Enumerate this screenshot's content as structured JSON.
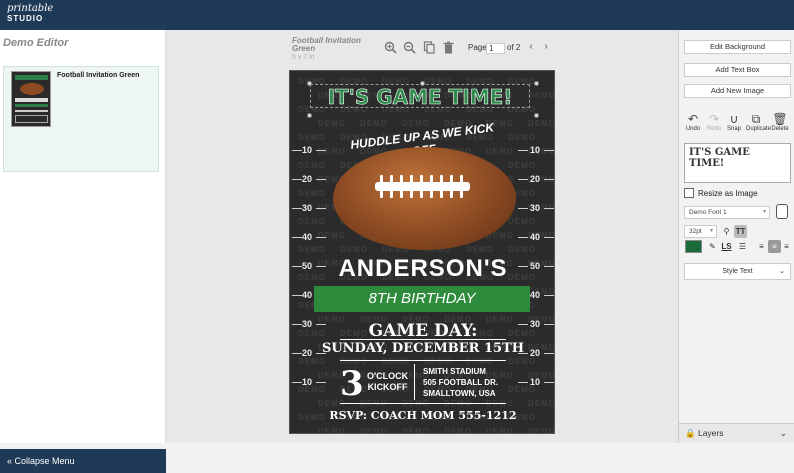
{
  "app": {
    "logo_line1": "printable",
    "logo_line2": "STUDIO"
  },
  "left_panel": {
    "title": "Demo Editor",
    "thumbnail_name": "Football Invitation Green",
    "collapse_label": "Collapse Menu"
  },
  "canvas_toolbar": {
    "doc_title": "Football Invitation Green",
    "doc_size": "5 x 7 in",
    "page_label": "Page",
    "page_value": "1",
    "page_of": "of 2",
    "icons": [
      "zoom-in-icon",
      "zoom-out-icon",
      "copy-icon",
      "trash-icon"
    ]
  },
  "invitation": {
    "banner": "IT'S GAME TIME!",
    "tagline": "HUDDLE UP AS WE KICK OFF",
    "name": "ANDERSON'S",
    "birthday": "8TH BIRTHDAY",
    "game_day": "GAME DAY:",
    "date": "SUNDAY, DECEMBER 15TH",
    "time_number": "3",
    "time_line1": "O'CLOCK",
    "time_line2": "KICKOFF",
    "venue_line1": "SMITH STADIUM",
    "venue_line2": "505 FOOTBALL DR.",
    "venue_line3": "SMALLTOWN, USA",
    "rsvp": "RSVP: COACH MOM 555-1212",
    "watermark": "DEMO",
    "yard_labels": [
      "10",
      "20",
      "30",
      "40",
      "50",
      "40",
      "30",
      "20",
      "10"
    ],
    "colors": {
      "green": "#2e8b4c",
      "background": "#2b2b2b",
      "ball": "#8b4a22"
    }
  },
  "right_panel": {
    "edit_background": "Edit Background",
    "add_text_box": "Add Text Box",
    "add_new_image": "Add New Image",
    "tools": [
      {
        "label": "Undo",
        "icon": "undo-icon"
      },
      {
        "label": "Redo",
        "icon": "redo-icon"
      },
      {
        "label": "Snap",
        "icon": "magnet-icon"
      },
      {
        "label": "Duplicate",
        "icon": "duplicate-icon"
      },
      {
        "label": "Delete",
        "icon": "trash-icon"
      }
    ],
    "text_value": "IT'S GAME TIME!",
    "resize_label": "Resize as Image",
    "font_select": "Demo Font 1",
    "size_select": "32pt",
    "style_text": "Style Text",
    "layers": "Layers",
    "text_color": "#1a6b3a"
  }
}
